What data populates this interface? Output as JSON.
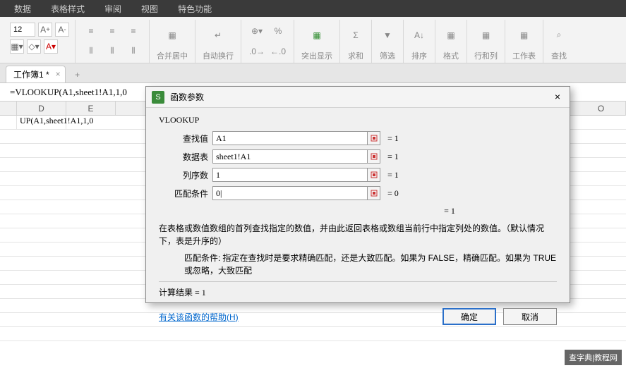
{
  "menu": {
    "items": [
      "数据",
      "表格样式",
      "审阅",
      "视图",
      "特色功能"
    ]
  },
  "ribbon": {
    "font_size": "12",
    "merge_label": "合并居中",
    "wrap_label": "自动换行",
    "highlight": "突出显示",
    "sum": "求和",
    "filter": "筛选",
    "sort": "排序",
    "format": "格式",
    "rowcol": "行和列",
    "worksheet": "工作表",
    "find": "查找"
  },
  "tab": {
    "name": "工作簿1 *",
    "close": "×",
    "add": "+"
  },
  "formula_bar": {
    "value": "=VLOOKUP(A1,sheet1!A1,1,0"
  },
  "columns": [
    "",
    "D",
    "E"
  ],
  "last_col": "O",
  "cell_a1": "UP(A1,sheet1!A1,1,0",
  "dialog": {
    "title": "函数参数",
    "close": "×",
    "func": "VLOOKUP",
    "args": [
      {
        "label": "查找值",
        "value": "A1",
        "result": "= 1"
      },
      {
        "label": "数据表",
        "value": "sheet1!A1",
        "result": "= 1"
      },
      {
        "label": "列序数",
        "value": "1",
        "result": "= 1"
      },
      {
        "label": "匹配条件",
        "value": "0|",
        "result": "= 0"
      }
    ],
    "formula_result": "= 1",
    "description1": "在表格或数值数组的首列查找指定的数值，并由此返回表格或数组当前行中指定列处的数值。（默认情况下，表是升序的）",
    "description2_label": "匹配条件:",
    "description2_text": "指定在查找时是要求精确匹配，还是大致匹配。如果为 FALSE，精确匹配。如果为 TRUE 或忽略，大致匹配",
    "calc_result": "计算结果 = 1",
    "help_link": "有关该函数的帮助(H)",
    "ok": "确定",
    "cancel": "取消"
  },
  "watermark": "查字典|教程网"
}
